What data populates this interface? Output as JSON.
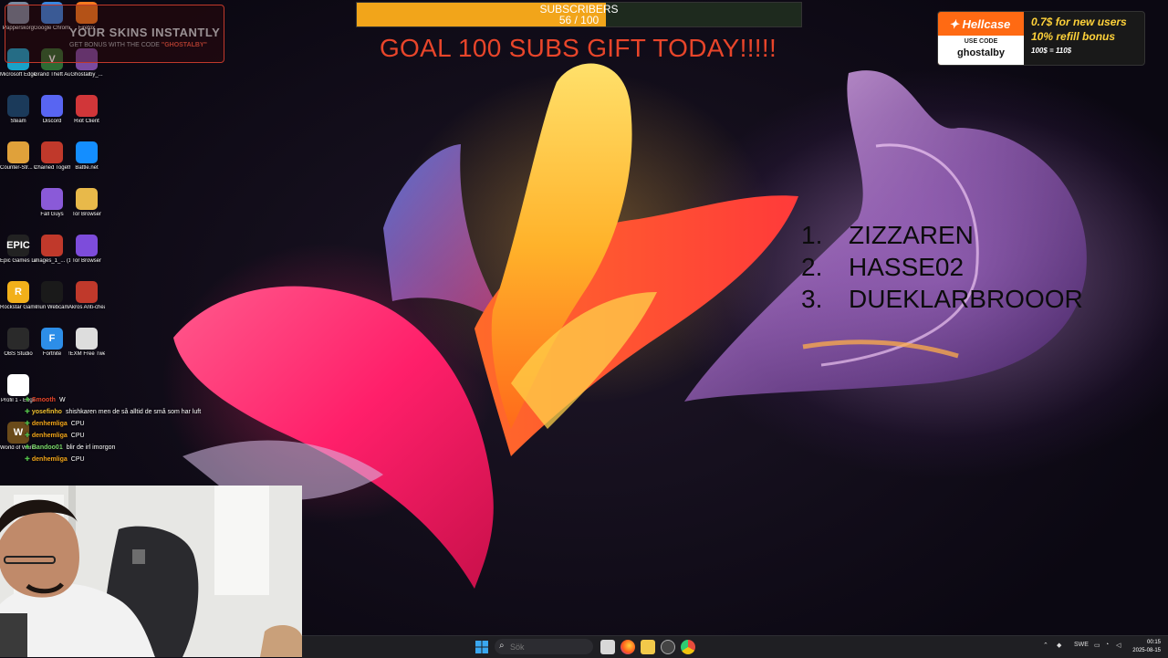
{
  "overlay": {
    "subscribers": {
      "label": "SUBSCRIBERS",
      "count_text": "56 / 100",
      "progress": 0.56
    },
    "goal_text": "GOAL 100 SUBS GIFT TODAY!!!!!",
    "promo_left": {
      "headline": "YOUR SKINS INSTANTLY",
      "subtext_prefix": "GET BONUS WITH THE CODE",
      "code": "\"GHOSTALBY\""
    },
    "hellcase": {
      "brand": "Hellcase",
      "use_code_label": "USE CODE",
      "code": "ghostalby",
      "line1": "0.7$ for new users",
      "line2": "10% refill bonus",
      "line3": "100$ = 110$"
    },
    "leaderboard": [
      {
        "rank": "1.",
        "name": "ZIZZAREN"
      },
      {
        "rank": "2.",
        "name": "HASSE02"
      },
      {
        "rank": "3.",
        "name": "DUEKLARBROOOR"
      }
    ],
    "chat": [
      {
        "user": "Smooth",
        "message": "W",
        "color": "#e8452a"
      },
      {
        "user": "yosefinho",
        "message": "shishkaren men de så alltid de små som har luft",
        "color": "#f2c230"
      },
      {
        "user": "denhemliga",
        "message": "CPU",
        "color": "#f2a51a"
      },
      {
        "user": "denhemliga",
        "message": "CPU",
        "color": "#f2a51a"
      },
      {
        "user": "Bandoo01",
        "message": "blir de irl imorgon",
        "color": "#7ad96a"
      },
      {
        "user": "denhemliga",
        "message": "CPU",
        "color": "#f2a51a"
      }
    ]
  },
  "desktop_icons": [
    {
      "label": "Papperskorg",
      "icon": "recycle-bin-icon",
      "color": "#7a8aa0",
      "glyph": ""
    },
    {
      "label": "Google Chrome",
      "icon": "chrome-icon",
      "color": "#3a86e0",
      "glyph": ""
    },
    {
      "label": "Firefox",
      "icon": "firefox-icon",
      "color": "#f57a1f",
      "glyph": ""
    },
    {
      "label": "Microsoft Edge",
      "icon": "edge-icon",
      "color": "#1aa2c8",
      "glyph": ""
    },
    {
      "label": "Grand Theft Auto V",
      "icon": "gta-icon",
      "color": "#2e6b34",
      "glyph": "V"
    },
    {
      "label": "Ghostalby_...",
      "icon": "file-icon",
      "color": "#7a4aa0",
      "glyph": ""
    },
    {
      "label": "Steam",
      "icon": "steam-icon",
      "color": "#1b3a5a",
      "glyph": ""
    },
    {
      "label": "Discord",
      "icon": "discord-icon",
      "color": "#5865f2",
      "glyph": ""
    },
    {
      "label": "Riot Client",
      "icon": "riot-icon",
      "color": "#d13639",
      "glyph": ""
    },
    {
      "label": "Counter-Str... 2",
      "icon": "cs2-icon",
      "color": "#e0a13a",
      "glyph": ""
    },
    {
      "label": "Chained Together",
      "icon": "chained-together-icon",
      "color": "#c0392b",
      "glyph": ""
    },
    {
      "label": "Battle.net",
      "icon": "battlenet-icon",
      "color": "#148eff",
      "glyph": ""
    },
    {
      "label": "Fall Guys",
      "icon": "fall-guys-icon",
      "color": "#8a5ad8",
      "glyph": ""
    },
    {
      "label": "Tor Browser",
      "icon": "folder-icon",
      "color": "#e8b94a",
      "glyph": ""
    },
    {
      "label": "Epic Games Launcher",
      "icon": "epic-games-icon",
      "color": "#222222",
      "glyph": "EPIC"
    },
    {
      "label": "images_1_... (1)",
      "icon": "archive-icon",
      "color": "#c0392b",
      "glyph": ""
    },
    {
      "label": "Tor Browser",
      "icon": "tor-icon",
      "color": "#7d4cdb",
      "glyph": ""
    },
    {
      "label": "Rockstar Games ...",
      "icon": "rockstar-icon",
      "color": "#f2b01a",
      "glyph": "R"
    },
    {
      "label": "Iriun Webcam",
      "icon": "webcam-icon",
      "color": "#1a1a1a",
      "glyph": ""
    },
    {
      "label": "Akros Anti-cheat",
      "icon": "anticheat-icon",
      "color": "#c0392b",
      "glyph": ""
    },
    {
      "label": "OBS Studio",
      "icon": "obs-icon",
      "color": "#2a2a2a",
      "glyph": ""
    },
    {
      "label": "Fortnite",
      "icon": "fortnite-icon",
      "color": "#2d8ee8",
      "glyph": "F"
    },
    {
      "label": "!EXM Free Tweakin...",
      "icon": "tweak-icon",
      "color": "#dddddd",
      "glyph": ""
    },
    {
      "label": "Profil 1 - Edge",
      "icon": "document-icon",
      "color": "#ffffff",
      "glyph": ""
    },
    {
      "label": "World of Warcraft",
      "icon": "wow-icon",
      "color": "#6a4a1a",
      "glyph": "W"
    }
  ],
  "taskbar": {
    "search_placeholder": "Sök",
    "apps": [
      "file-explorer-icon",
      "firefox-icon",
      "folder-icon",
      "settings-icon",
      "chrome-icon"
    ],
    "tray_lang": "SWE",
    "time": "00:15",
    "date": "2025-08-15"
  }
}
